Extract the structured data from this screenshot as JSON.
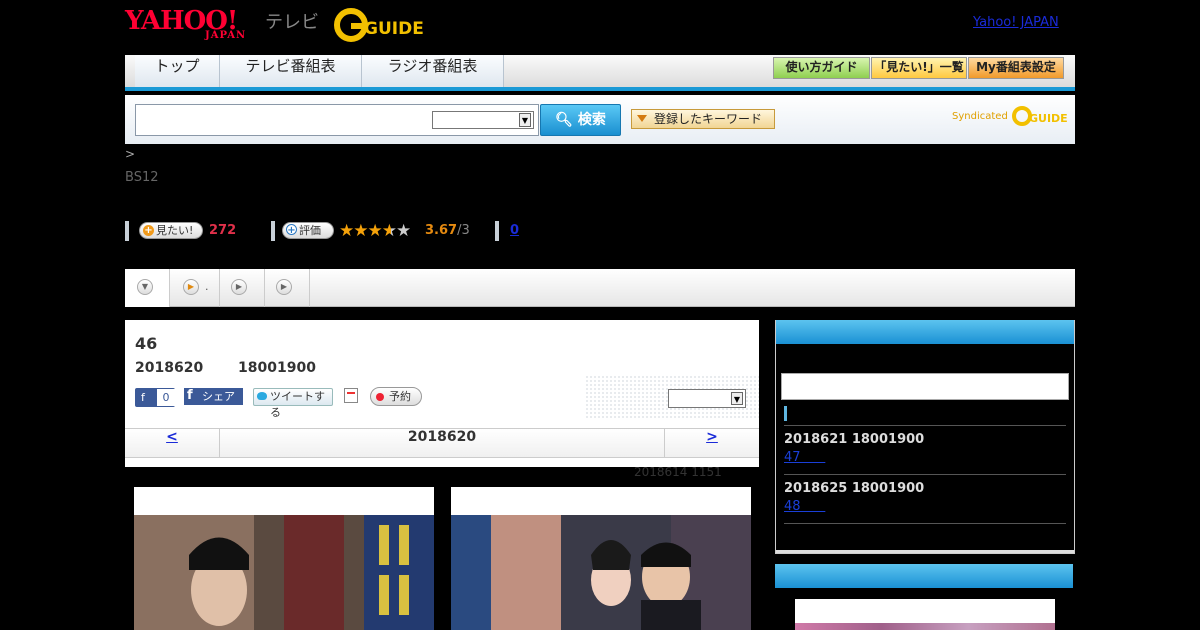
{
  "header": {
    "yahoo_logo": "YAHOO!",
    "yahoo_sub": "JAPAN",
    "tv_label": "テレビ",
    "gguide_logo": "G-GUIDE",
    "yahoo_japan_link": "Yahoo! JAPAN"
  },
  "nav": {
    "tabs": [
      "トップ",
      "テレビ番組表",
      "ラジオ番組表"
    ],
    "buttons": [
      "使い方ガイド",
      "「見たい!」一覧",
      "My番組表設定"
    ],
    "button_colors": [
      "#a8e070",
      "#ffd766",
      "#f5a030"
    ]
  },
  "search": {
    "button_label": "検索",
    "keyword_button": "登録したキーワード",
    "syndicated": "Syndicated"
  },
  "breadcrumb": ">",
  "channel": "BS12",
  "rating": {
    "want_label": "見たい!",
    "want_count": "272",
    "review_label": "評価",
    "score": "3.67",
    "score_total": "/3",
    "stars_glyphs": "★★★★★",
    "review_count": "0"
  },
  "program_tabs": [
    "",
    ".",
    "",
    ""
  ],
  "episode": {
    "title": "46",
    "date": "2018620",
    "time": "18001900",
    "fb_like": "0",
    "fb_share": "シェア",
    "tweet": "ツイートする",
    "reserve": "予約",
    "pager_prev": "<",
    "pager_date": "2018620",
    "pager_next": ">",
    "updated": "2018614  1151"
  },
  "sidebar": {
    "upcoming": [
      {
        "date": "2018621  18001900",
        "link": "47      "
      },
      {
        "date": "2018625  18001900",
        "link": "48      "
      }
    ]
  }
}
